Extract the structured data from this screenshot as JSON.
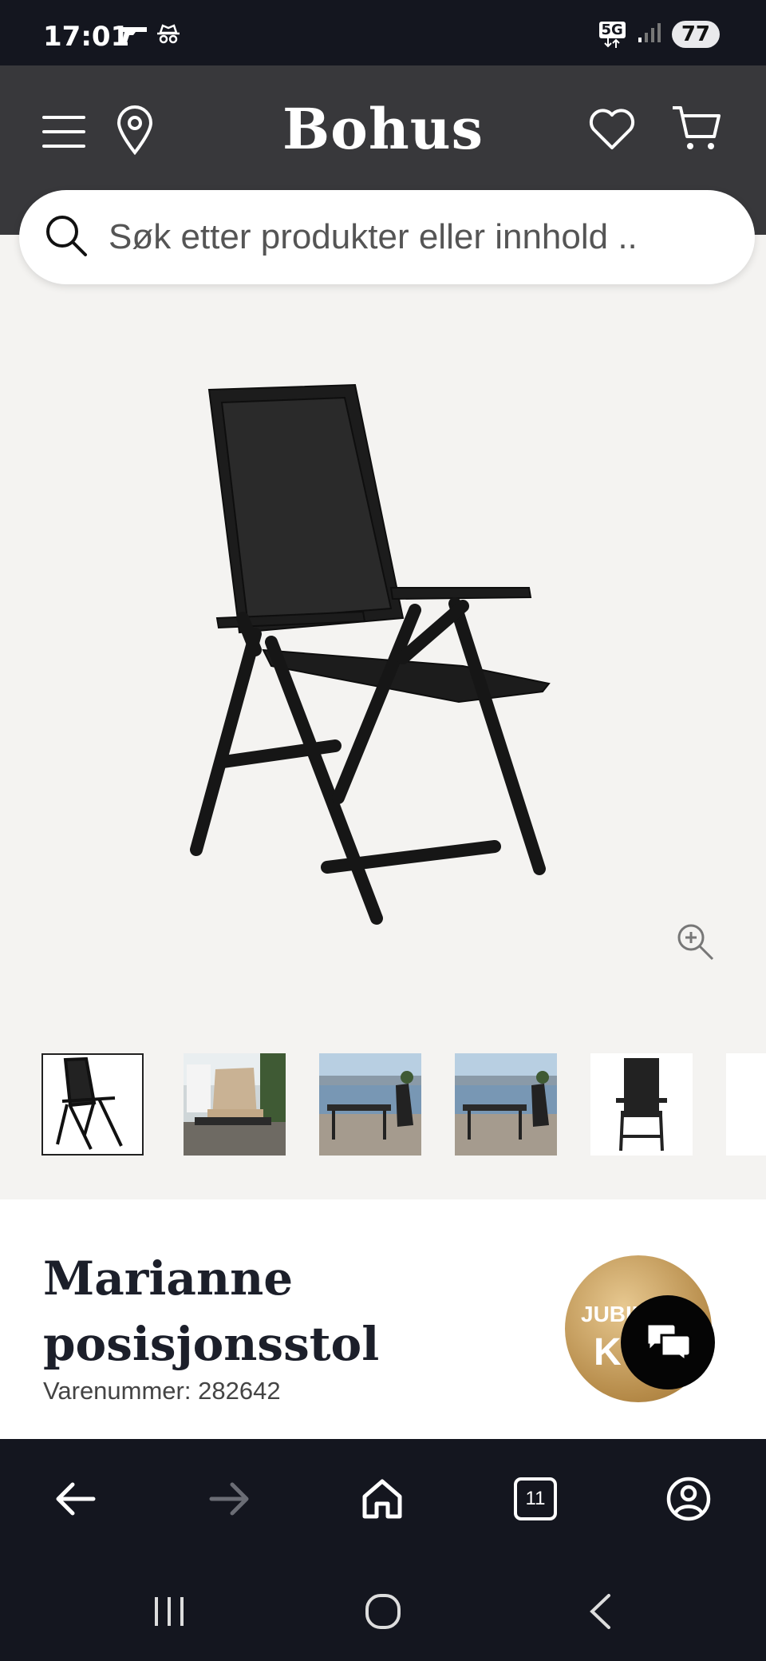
{
  "status_bar": {
    "time": "17:01",
    "network": "5G",
    "battery": "77",
    "icons": [
      "gun-icon",
      "incognito-icon",
      "signal-icon"
    ]
  },
  "header": {
    "logo": "Bohus",
    "icons": [
      "menu-icon",
      "location-pin-icon",
      "heart-icon",
      "cart-icon"
    ]
  },
  "search": {
    "placeholder": "Søk etter produkter eller innhold .."
  },
  "product": {
    "title_line1": "Marianne",
    "title_line2": "posisjonsstol",
    "sku_label": "Varenummer:",
    "sku_value": "282642",
    "badge_line1": "JUBIL",
    "badge_line2": "KU",
    "thumbnails": [
      "thumb-chair-side",
      "thumb-chair-cushion-lifestyle",
      "thumb-terrace-sea-1",
      "thumb-terrace-sea-2",
      "thumb-chair-front"
    ]
  },
  "browser_bar": {
    "tabs_count": "11",
    "icons": [
      "back-arrow-icon",
      "forward-arrow-icon",
      "home-icon",
      "tabs-icon",
      "account-icon"
    ]
  },
  "system_nav": {
    "icons": [
      "recent-apps-icon",
      "home-circle-icon",
      "back-chevron-icon"
    ]
  },
  "colors": {
    "header_bg": "#38383b",
    "system_bg": "#14161f",
    "product_bg": "#f4f3f1",
    "title_color": "#1c1f2a",
    "badge_gold": "#b58a48"
  }
}
